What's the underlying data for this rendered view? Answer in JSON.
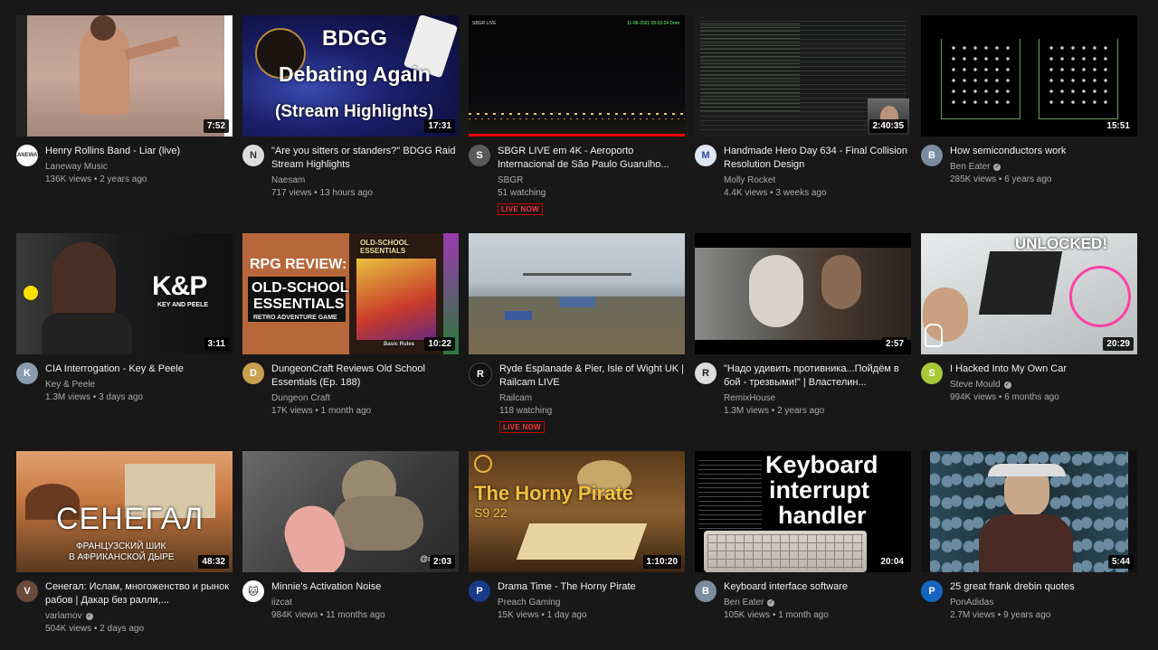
{
  "videos": [
    {
      "title": "Henry Rollins Band - Liar (live)",
      "channel": "Laneway Music",
      "stats": "136K views • 2 years ago",
      "duration": "7:52"
    },
    {
      "title": "\"Are you sitters or standers?\" BDGG Raid Stream Highlights",
      "channel": "Naesam",
      "stats": "717 views • 13 hours ago",
      "duration": "17:31",
      "thumb_text": [
        "BDGG",
        "Debating Again",
        "(Stream Highlights)"
      ]
    },
    {
      "title": "SBGR LIVE em 4K - Aeroporto Internacional de São Paulo Guarulho...",
      "channel": "SBGR",
      "stats": "51 watching",
      "live": "LIVE NOW",
      "thumb_text": [
        "SBGR LIVE",
        "11-06-2021 05:03:24 Dom"
      ]
    },
    {
      "title": "Handmade Hero Day 634 - Final Collision Resolution Design",
      "channel": "Molly Rocket",
      "stats": "4.4K views • 3 weeks ago",
      "duration": "2:40:35"
    },
    {
      "title": "How semiconductors work",
      "channel": "Ben Eater",
      "stats": "285K views • 6 years ago",
      "duration": "15:51",
      "verified": true
    },
    {
      "title": "CIA Interrogation - Key & Peele",
      "channel": "Key & Peele",
      "stats": "1.3M views • 3 days ago",
      "duration": "3:11",
      "thumb_text": [
        "K&P",
        "KEY AND PEELE"
      ]
    },
    {
      "title": "DungeonCraft Reviews Old School Essentials (Ep. 188)",
      "channel": "Dungeon Craft",
      "stats": "17K views • 1 month ago",
      "duration": "10:22",
      "thumb_text": [
        "RPG REVIEW:",
        "OLD-SCHOOL",
        "ESSENTIALS",
        "RETRO ADVENTURE GAME",
        "OLD-SCHOOL ESSENTIALS",
        "Basic Rules"
      ]
    },
    {
      "title": "Ryde Esplanade & Pier, Isle of Wight UK | Railcam LIVE",
      "channel": "Railcam",
      "stats": "118 watching",
      "live": "LIVE NOW"
    },
    {
      "title": "\"Надо удивить противника...Пойдём в бой - трезвыми!\" | Властелин...",
      "channel": "RemixHouse",
      "stats": "1.3M views • 2 years ago",
      "duration": "2:57"
    },
    {
      "title": "I Hacked Into My Own Car",
      "channel": "Steve Mould",
      "stats": "994K views • 6 months ago",
      "duration": "20:29",
      "verified": true,
      "thumb_text": [
        "UNLOCKED!"
      ]
    },
    {
      "title": "Сенегал: Ислам, многоженство и рынок рабов | Дакар без ралли,...",
      "channel": "varlamov",
      "stats": "504K views • 2 days ago",
      "duration": "48:32",
      "verified": true,
      "thumb_text": [
        "СЕНЕГАЛ",
        "ФРАНЦУЗСКИЙ ШИК",
        "В АФРИКАНСКОЙ ДЫРЕ"
      ]
    },
    {
      "title": "Minnie's Activation Noise",
      "channel": "iizcat",
      "stats": "984K views • 11 months ago",
      "duration": "2:03",
      "thumb_text": [
        "@iizcat"
      ]
    },
    {
      "title": "Drama Time - The Horny Pirate",
      "channel": "Preach Gaming",
      "stats": "15K views • 1 day ago",
      "duration": "1:10:20",
      "thumb_text": [
        "The Horny Pirate",
        "S9 22"
      ]
    },
    {
      "title": "Keyboard interface software",
      "channel": "Ben Eater",
      "stats": "105K views • 1 month ago",
      "duration": "20:04",
      "verified": true,
      "thumb_text": [
        "Keyboard",
        "interrupt",
        "handler"
      ]
    },
    {
      "title": "25 great frank drebin quotes",
      "channel": "PonAdidas",
      "stats": "2.7M views • 9 years ago",
      "duration": "5:44",
      "avatar_letter": "P"
    }
  ],
  "colors": {
    "background": "#181818",
    "live": "#cc0000",
    "title": "#f1f1f1",
    "secondary": "#aaaaaa"
  }
}
